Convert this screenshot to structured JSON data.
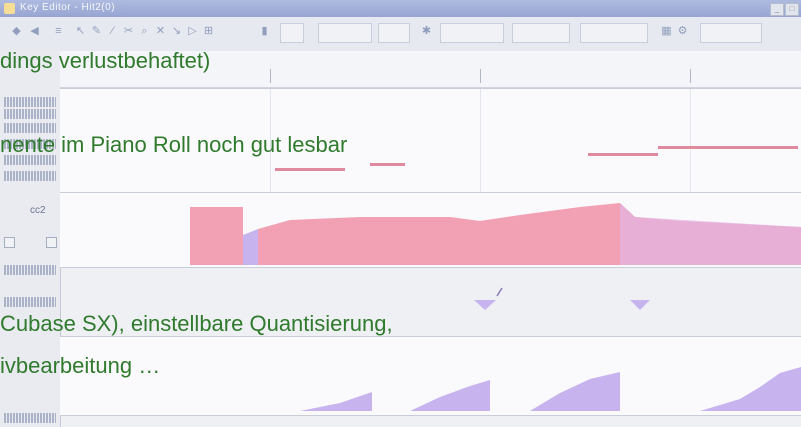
{
  "window": {
    "title": "Key Editor - Hit2(0)",
    "minimize_label": "_",
    "restore_label": "□"
  },
  "toolbar": {
    "icons": [
      "solo-icon",
      "feedback-icon",
      "autoscroll-icon",
      "arrow-icon",
      "pencil-icon",
      "line-icon",
      "glue-icon",
      "zoom-icon",
      "mute-icon",
      "split-icon",
      "play-icon",
      "grid-icon",
      "step-icon",
      "note-color-icon",
      "quantize-icon",
      "length-icon",
      "color-icon"
    ]
  },
  "overlay_text": {
    "line1": "dings verlustbehaftet)",
    "line2": "nente im Piano Roll noch gut lesbar",
    "line3": "Cubase SX), einstellbare Quantisierung,",
    "line4": "ivbearbeitung …"
  },
  "controller_lane": {
    "label": "cc2"
  },
  "colors": {
    "velocity_red": "#f2a0b4",
    "velocity_blue": "#c7b3ee",
    "text_green": "#2f7a2c",
    "note_pink": "#e08aa0"
  }
}
